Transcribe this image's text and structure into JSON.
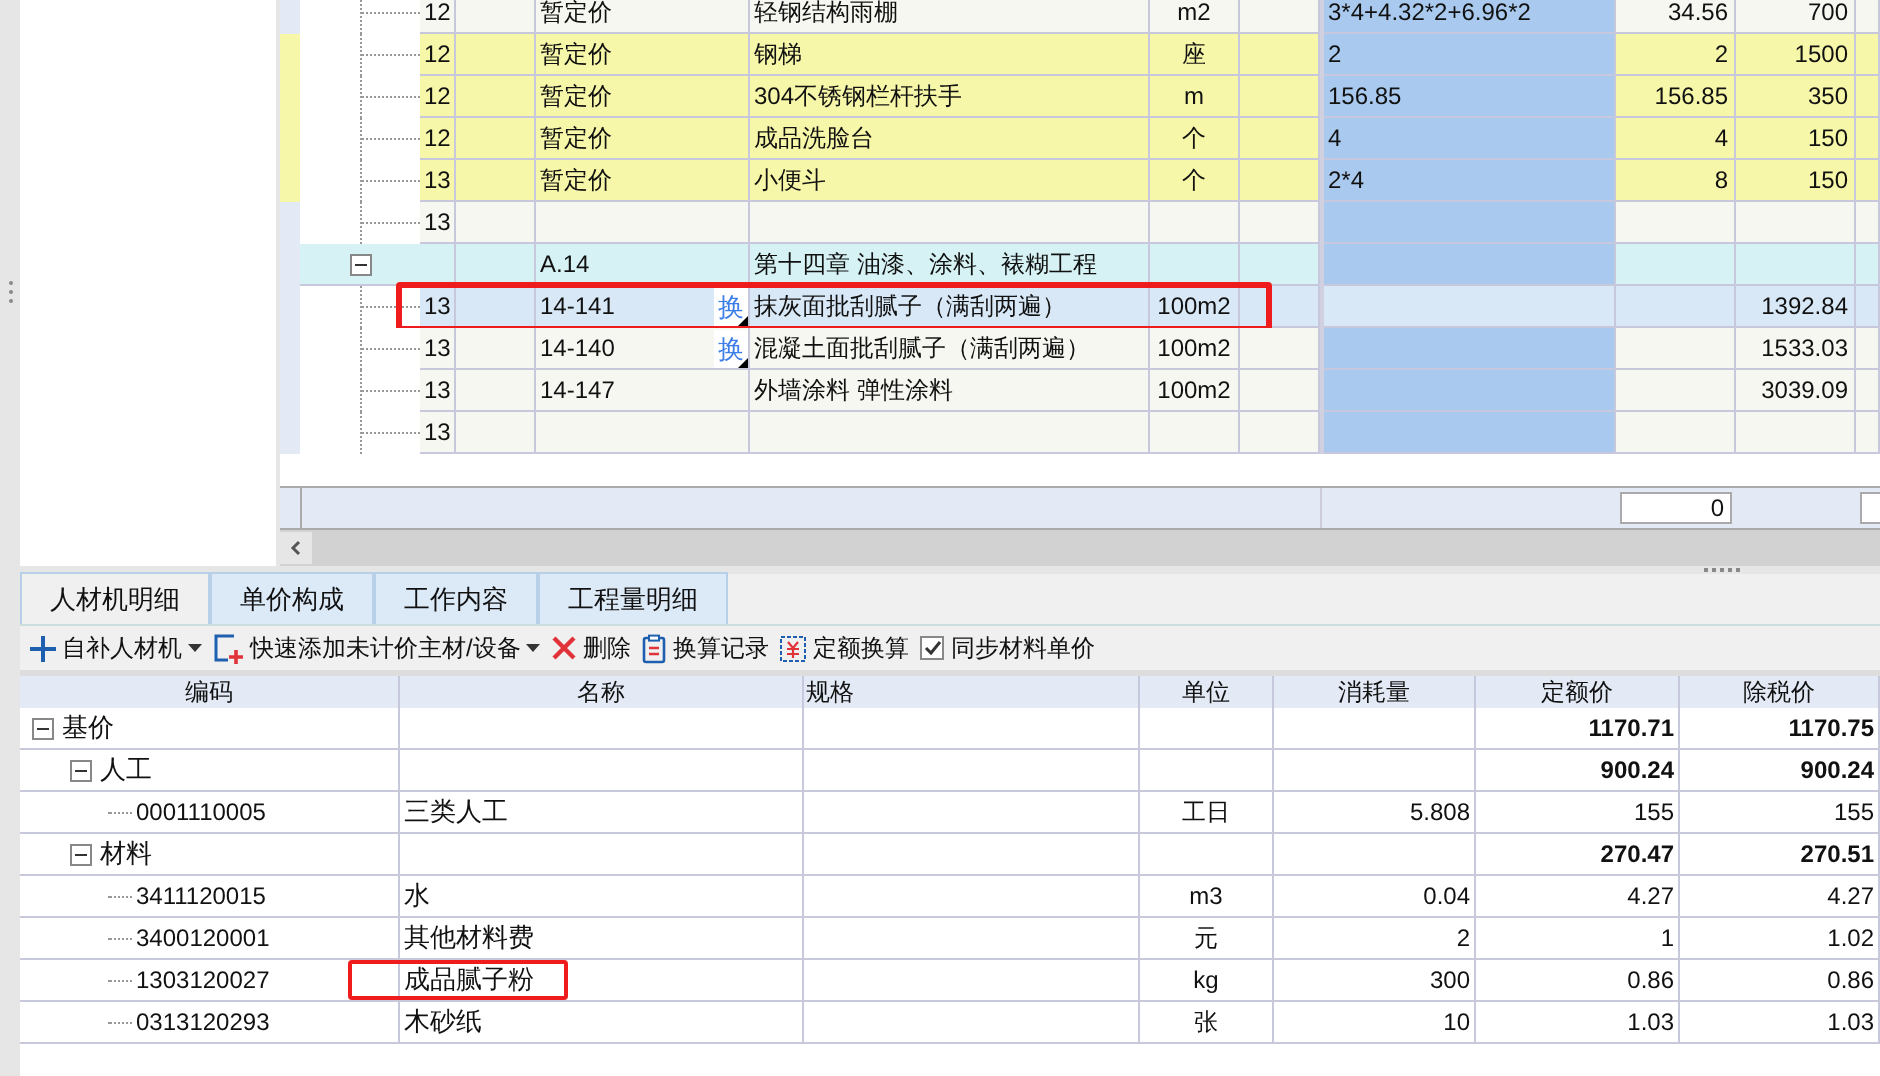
{
  "upper_grid": {
    "rows": [
      {
        "kind": "item",
        "selected": false,
        "highlighted": false,
        "number": "12",
        "code": "暂定价",
        "name": "轻钢结构雨棚",
        "unit": "m2",
        "expression": "3*4+4.32*2+6.96*2",
        "quantity": "34.56",
        "price": "700"
      },
      {
        "kind": "provisional",
        "selected": false,
        "highlighted": false,
        "number": "12",
        "code": "暂定价",
        "name": "钢梯",
        "unit": "座",
        "expression": "2",
        "quantity": "2",
        "price": "1500"
      },
      {
        "kind": "provisional",
        "selected": false,
        "highlighted": false,
        "number": "12",
        "code": "暂定价",
        "name": "304不锈钢栏杆扶手",
        "unit": "m",
        "expression": "156.85",
        "quantity": "156.85",
        "price": "350"
      },
      {
        "kind": "provisional",
        "selected": false,
        "highlighted": false,
        "number": "12",
        "code": "暂定价",
        "name": "成品洗脸台",
        "unit": "个",
        "expression": "4",
        "quantity": "4",
        "price": "150"
      },
      {
        "kind": "provisional",
        "selected": false,
        "highlighted": false,
        "number": "13",
        "code": "暂定价",
        "name": "小便斗",
        "unit": "个",
        "expression": "2*4",
        "quantity": "8",
        "price": "150"
      },
      {
        "kind": "item",
        "selected": false,
        "highlighted": false,
        "number": "13"
      },
      {
        "kind": "chapter",
        "selected": false,
        "highlighted": false,
        "expanded": true,
        "code": "A.14",
        "name": "第十四章 油漆、涂料、裱糊工程"
      },
      {
        "kind": "item",
        "selected": true,
        "highlighted": true,
        "number": "13",
        "code": "14-141",
        "swap_mark": "换",
        "name": "抹灰面批刮腻子（满刮两遍）",
        "unit": "100m2",
        "price": "1392.84"
      },
      {
        "kind": "item",
        "selected": false,
        "highlighted": false,
        "number": "13",
        "code": "14-140",
        "swap_mark": "换",
        "name": "混凝土面批刮腻子（满刮两遍）",
        "unit": "100m2",
        "price": "1533.03"
      },
      {
        "kind": "item",
        "selected": false,
        "highlighted": false,
        "number": "13",
        "code": "14-147",
        "name": "外墙涂料 弹性涂料",
        "unit": "100m2",
        "price": "3039.09"
      },
      {
        "kind": "item",
        "selected": false,
        "highlighted": false,
        "number": "13"
      }
    ],
    "summary": {
      "quantity_total": "0"
    }
  },
  "tabs": [
    {
      "label": "人材机明细",
      "selected": true
    },
    {
      "label": "单价构成",
      "selected": false
    },
    {
      "label": "工作内容",
      "selected": false
    },
    {
      "label": "工程量明细",
      "selected": false
    }
  ],
  "toolbar": {
    "items": [
      {
        "kind": "add",
        "label": "自补人材机",
        "dropdown": true
      },
      {
        "kind": "quick_add",
        "label": "快速添加未计价主材/设备",
        "dropdown": true
      },
      {
        "kind": "delete",
        "label": "删除",
        "dropdown": false
      },
      {
        "kind": "record",
        "label": "换算记录",
        "dropdown": false
      },
      {
        "kind": "convert",
        "label": "定额换算",
        "dropdown": false
      }
    ],
    "sync_checkbox": {
      "label": "同步材料单价",
      "checked": true
    }
  },
  "detail_table": {
    "columns": [
      "编码",
      "名称",
      "规格",
      "单位",
      "消耗量",
      "定额价",
      "除税价"
    ],
    "rows": [
      {
        "kind": "group",
        "expanded": true,
        "code": "基价",
        "quota_price": "1170.71",
        "net_price": "1170.75",
        "children": [
          {
            "kind": "group",
            "expanded": true,
            "code": "人工",
            "quota_price": "900.24",
            "net_price": "900.24",
            "children": [
              {
                "kind": "item",
                "highlighted": false,
                "code": "0001110005",
                "name": "三类人工",
                "unit": "工日",
                "consumption": "5.808",
                "quota_price": "155",
                "net_price": "155"
              }
            ]
          },
          {
            "kind": "group",
            "expanded": true,
            "code": "材料",
            "quota_price": "270.47",
            "net_price": "270.51",
            "children": [
              {
                "kind": "item",
                "highlighted": false,
                "code": "3411120015",
                "name": "水",
                "unit": "m3",
                "consumption": "0.04",
                "quota_price": "4.27",
                "net_price": "4.27"
              },
              {
                "kind": "item",
                "highlighted": false,
                "code": "3400120001",
                "name": "其他材料费",
                "unit": "元",
                "consumption": "2",
                "quota_price": "1",
                "net_price": "1.02"
              },
              {
                "kind": "item",
                "highlighted": true,
                "code": "1303120027",
                "name": "成品腻子粉",
                "unit": "kg",
                "consumption": "300",
                "quota_price": "0.86",
                "net_price": "0.86"
              },
              {
                "kind": "item",
                "highlighted": false,
                "code": "0313120293",
                "name": "木砂纸",
                "unit": "张",
                "consumption": "10",
                "quota_price": "1.03",
                "net_price": "1.03"
              }
            ]
          }
        ]
      }
    ]
  }
}
